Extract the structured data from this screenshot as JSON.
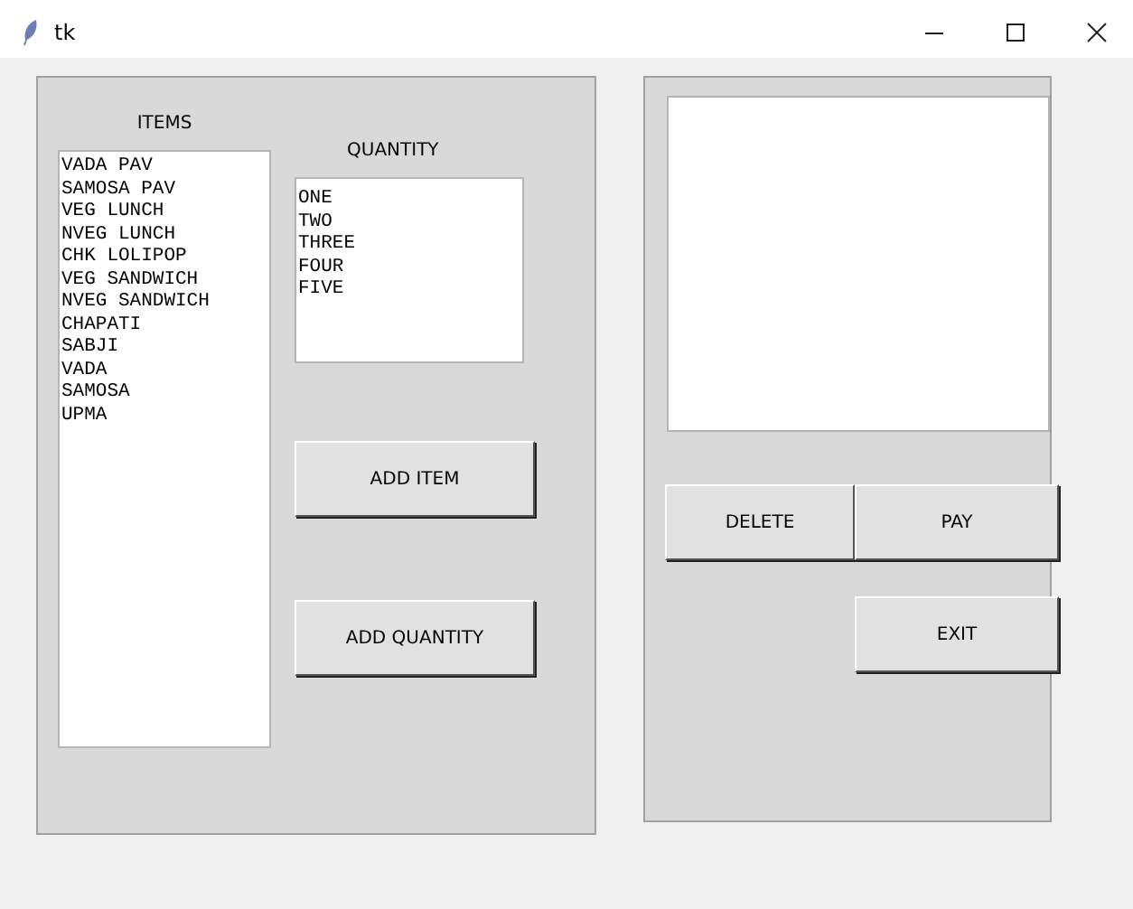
{
  "window": {
    "title": "tk"
  },
  "items": {
    "label": "ITEMS",
    "entries": [
      "VADA PAV",
      "SAMOSA PAV",
      "VEG LUNCH",
      "NVEG LUNCH",
      "CHK LOLIPOP",
      "VEG SANDWICH",
      "NVEG SANDWICH",
      "CHAPATI",
      "SABJI",
      "VADA",
      "SAMOSA",
      "UPMA"
    ]
  },
  "quantity": {
    "label": "QUANTITY",
    "entries": [
      "ONE",
      "TWO",
      "THREE",
      "FOUR",
      "FIVE"
    ]
  },
  "left_buttons": [
    "ADD ITEM",
    "ADD QUANTITY"
  ],
  "right_buttons": [
    "DELETE",
    "PAY",
    "EXIT"
  ]
}
